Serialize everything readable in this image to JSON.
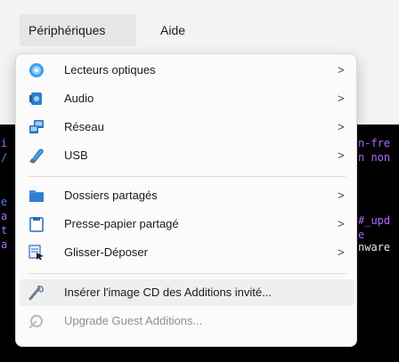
{
  "menubar": {
    "items": [
      {
        "label": "Périphériques",
        "active": true
      },
      {
        "label": "Aide",
        "active": false
      }
    ]
  },
  "terminal": {
    "fragments": [
      "i",
      "/",
      "e",
      "a",
      "t",
      "a",
      "n-fre",
      "n non",
      "#_upd",
      "e",
      "nware"
    ],
    "colors": {
      "purple": "#b36bff",
      "blue": "#5a7dff",
      "white": "#e8e8e8"
    }
  },
  "menu": {
    "items": [
      {
        "label": "Lecteurs optiques",
        "icon": "optical-disc-icon",
        "submenu": true,
        "submenu_arrow": ">"
      },
      {
        "label": "Audio",
        "icon": "audio-card-icon",
        "submenu": true,
        "submenu_arrow": ">"
      },
      {
        "label": "Réseau",
        "icon": "network-icon",
        "submenu": true,
        "submenu_arrow": ">"
      },
      {
        "label": "USB",
        "icon": "usb-icon",
        "submenu": true,
        "submenu_arrow": ">"
      },
      {
        "label": "Dossiers partagés",
        "icon": "shared-folder-icon",
        "submenu": true,
        "submenu_arrow": ">"
      },
      {
        "label": "Presse-papier partagé",
        "icon": "clipboard-icon",
        "submenu": true,
        "submenu_arrow": ">"
      },
      {
        "label": "Glisser-Déposer",
        "icon": "drag-drop-icon",
        "submenu": true,
        "submenu_arrow": ">"
      },
      {
        "label": "Insérer l'image CD des Additions invité...",
        "icon": "insert-cd-icon",
        "submenu": false,
        "hovered": true
      },
      {
        "label": "Upgrade Guest Additions...",
        "icon": "upgrade-icon",
        "submenu": false,
        "disabled": true
      }
    ]
  }
}
